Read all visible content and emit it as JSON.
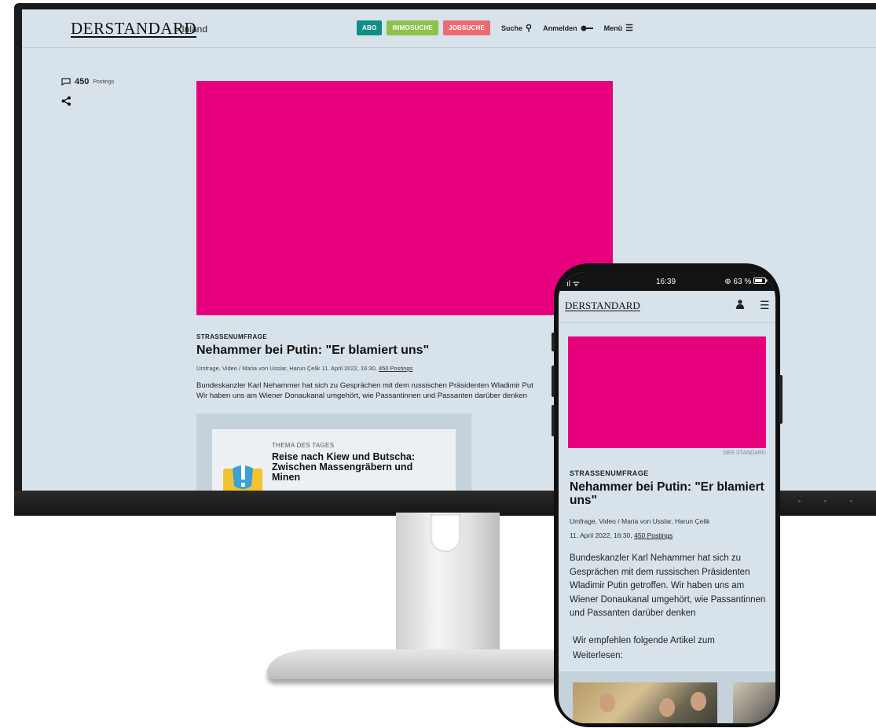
{
  "desktop": {
    "logo": "DERSTANDARD",
    "breadcrumb": "› Inland",
    "nav": {
      "abo": "ABO",
      "immo": "IMMOSUCHE",
      "jobs": "JOBSUCHE",
      "search": "Suche",
      "login": "Anmelden",
      "menu": "Menü"
    },
    "postings_count": "450",
    "postings_label": "Postings",
    "article": {
      "kicker": "STRASSENUMFRAGE",
      "title": "Nehammer bei Putin: \"Er blamiert uns\"",
      "meta": "Umfrage, Video / Maria von Usslar, Harun Çelik 11. April 2022, 16:30,",
      "meta_link": "450 Postings",
      "lead_line1": "Bundeskanzler Karl Nehammer hat sich zu Gesprächen mit dem russischen Präsidenten Wladimir Put",
      "lead_line2": "Wir haben uns am Wiener Donaukanal umgehört, wie Passantinnen und Passanten darüber denken"
    },
    "teaser": {
      "kicker": "THEMA DES TAGES",
      "title": "Reise nach Kiew und Butscha: Zwischen Massengräbern und Minen"
    }
  },
  "phone": {
    "status": {
      "left": "ıl ᯤ",
      "time": "16:39",
      "battery": "⊕ 63 %"
    },
    "logo": "DERSTANDARD",
    "hero_credit": "DER STANDARD",
    "article": {
      "kicker": "STRASSENUMFRAGE",
      "title": "Nehammer bei Putin: \"Er blamiert uns\"",
      "meta1": "Umfrage, Video / Maria von Usslar, Harun Çelik",
      "meta2": "11. April 2022, 16:30,",
      "meta_link": "450 Postings",
      "lead": "Bundeskanzler Karl Nehammer hat sich zu Gesprächen mit dem russischen Präsidenten Wladimir Putin getroffen. Wir haben uns am Wiener Donaukanal umgehört, wie Passantinnen und Passanten darüber denken"
    },
    "recommend": "Wir empfehlen folgende Artikel zum Weiterlesen:"
  },
  "colors": {
    "hero": "#e6007e",
    "page_bg": "#d7e2ea",
    "abo": "#0f8e85",
    "immo": "#8dc34a",
    "jobs": "#e96b73"
  }
}
